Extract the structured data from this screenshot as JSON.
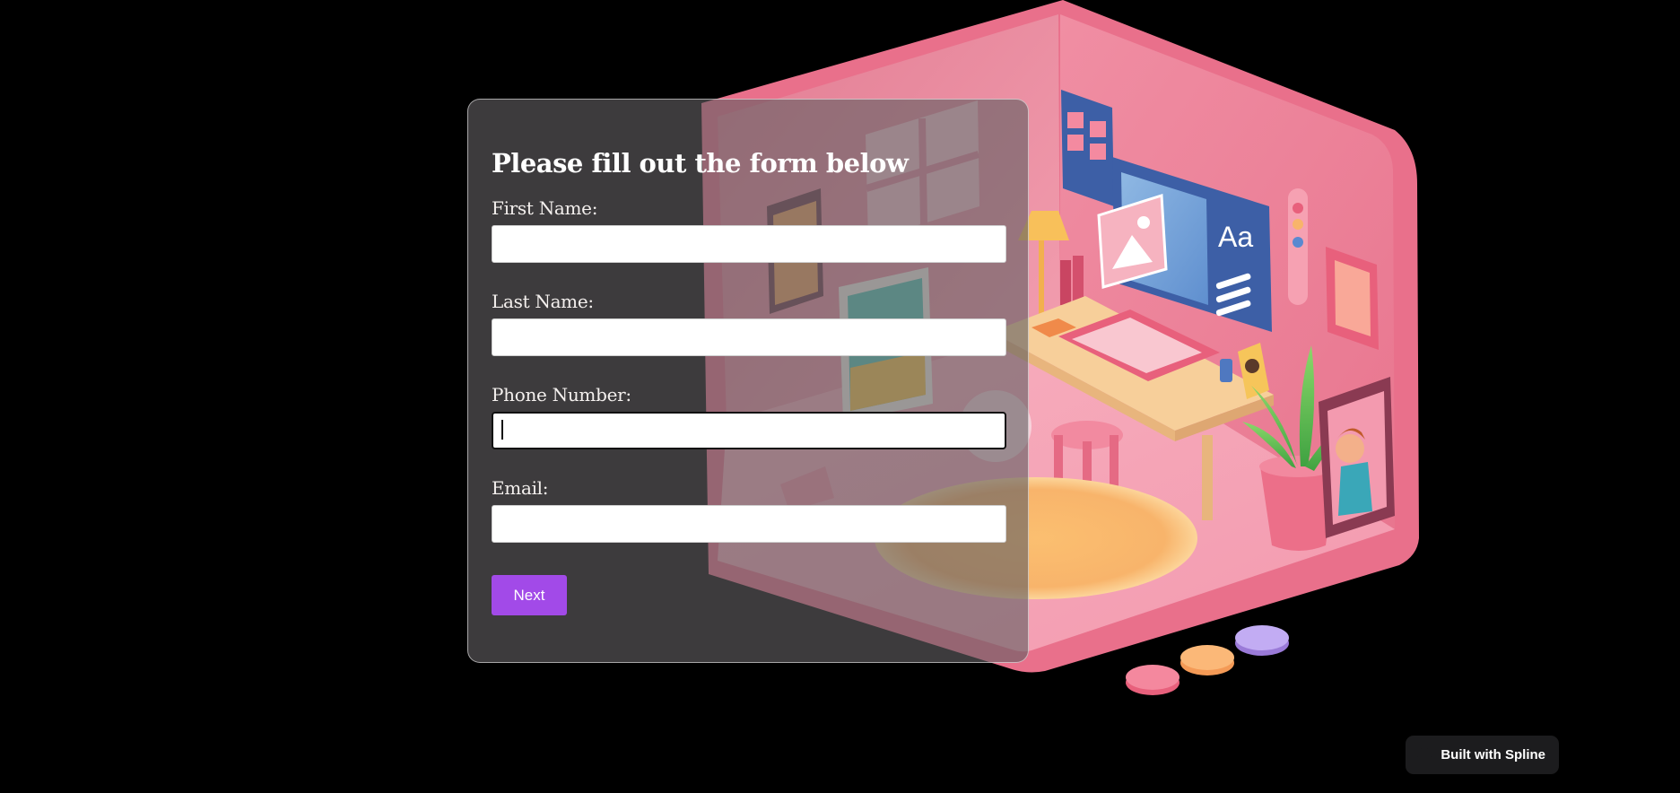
{
  "form": {
    "title": "Please fill out the form below",
    "fields": [
      {
        "label": "First Name:",
        "value": ""
      },
      {
        "label": "Last Name:",
        "value": ""
      },
      {
        "label": "Phone Number:",
        "value": ""
      },
      {
        "label": "Email:",
        "value": ""
      }
    ],
    "next_label": "Next"
  },
  "badge": {
    "label": "Built with Spline",
    "icon": "spline-logo-icon"
  },
  "colors": {
    "background": "#000000",
    "button": "#a24ae8",
    "room_pink": "#f48aa0",
    "panel": "#626062"
  }
}
